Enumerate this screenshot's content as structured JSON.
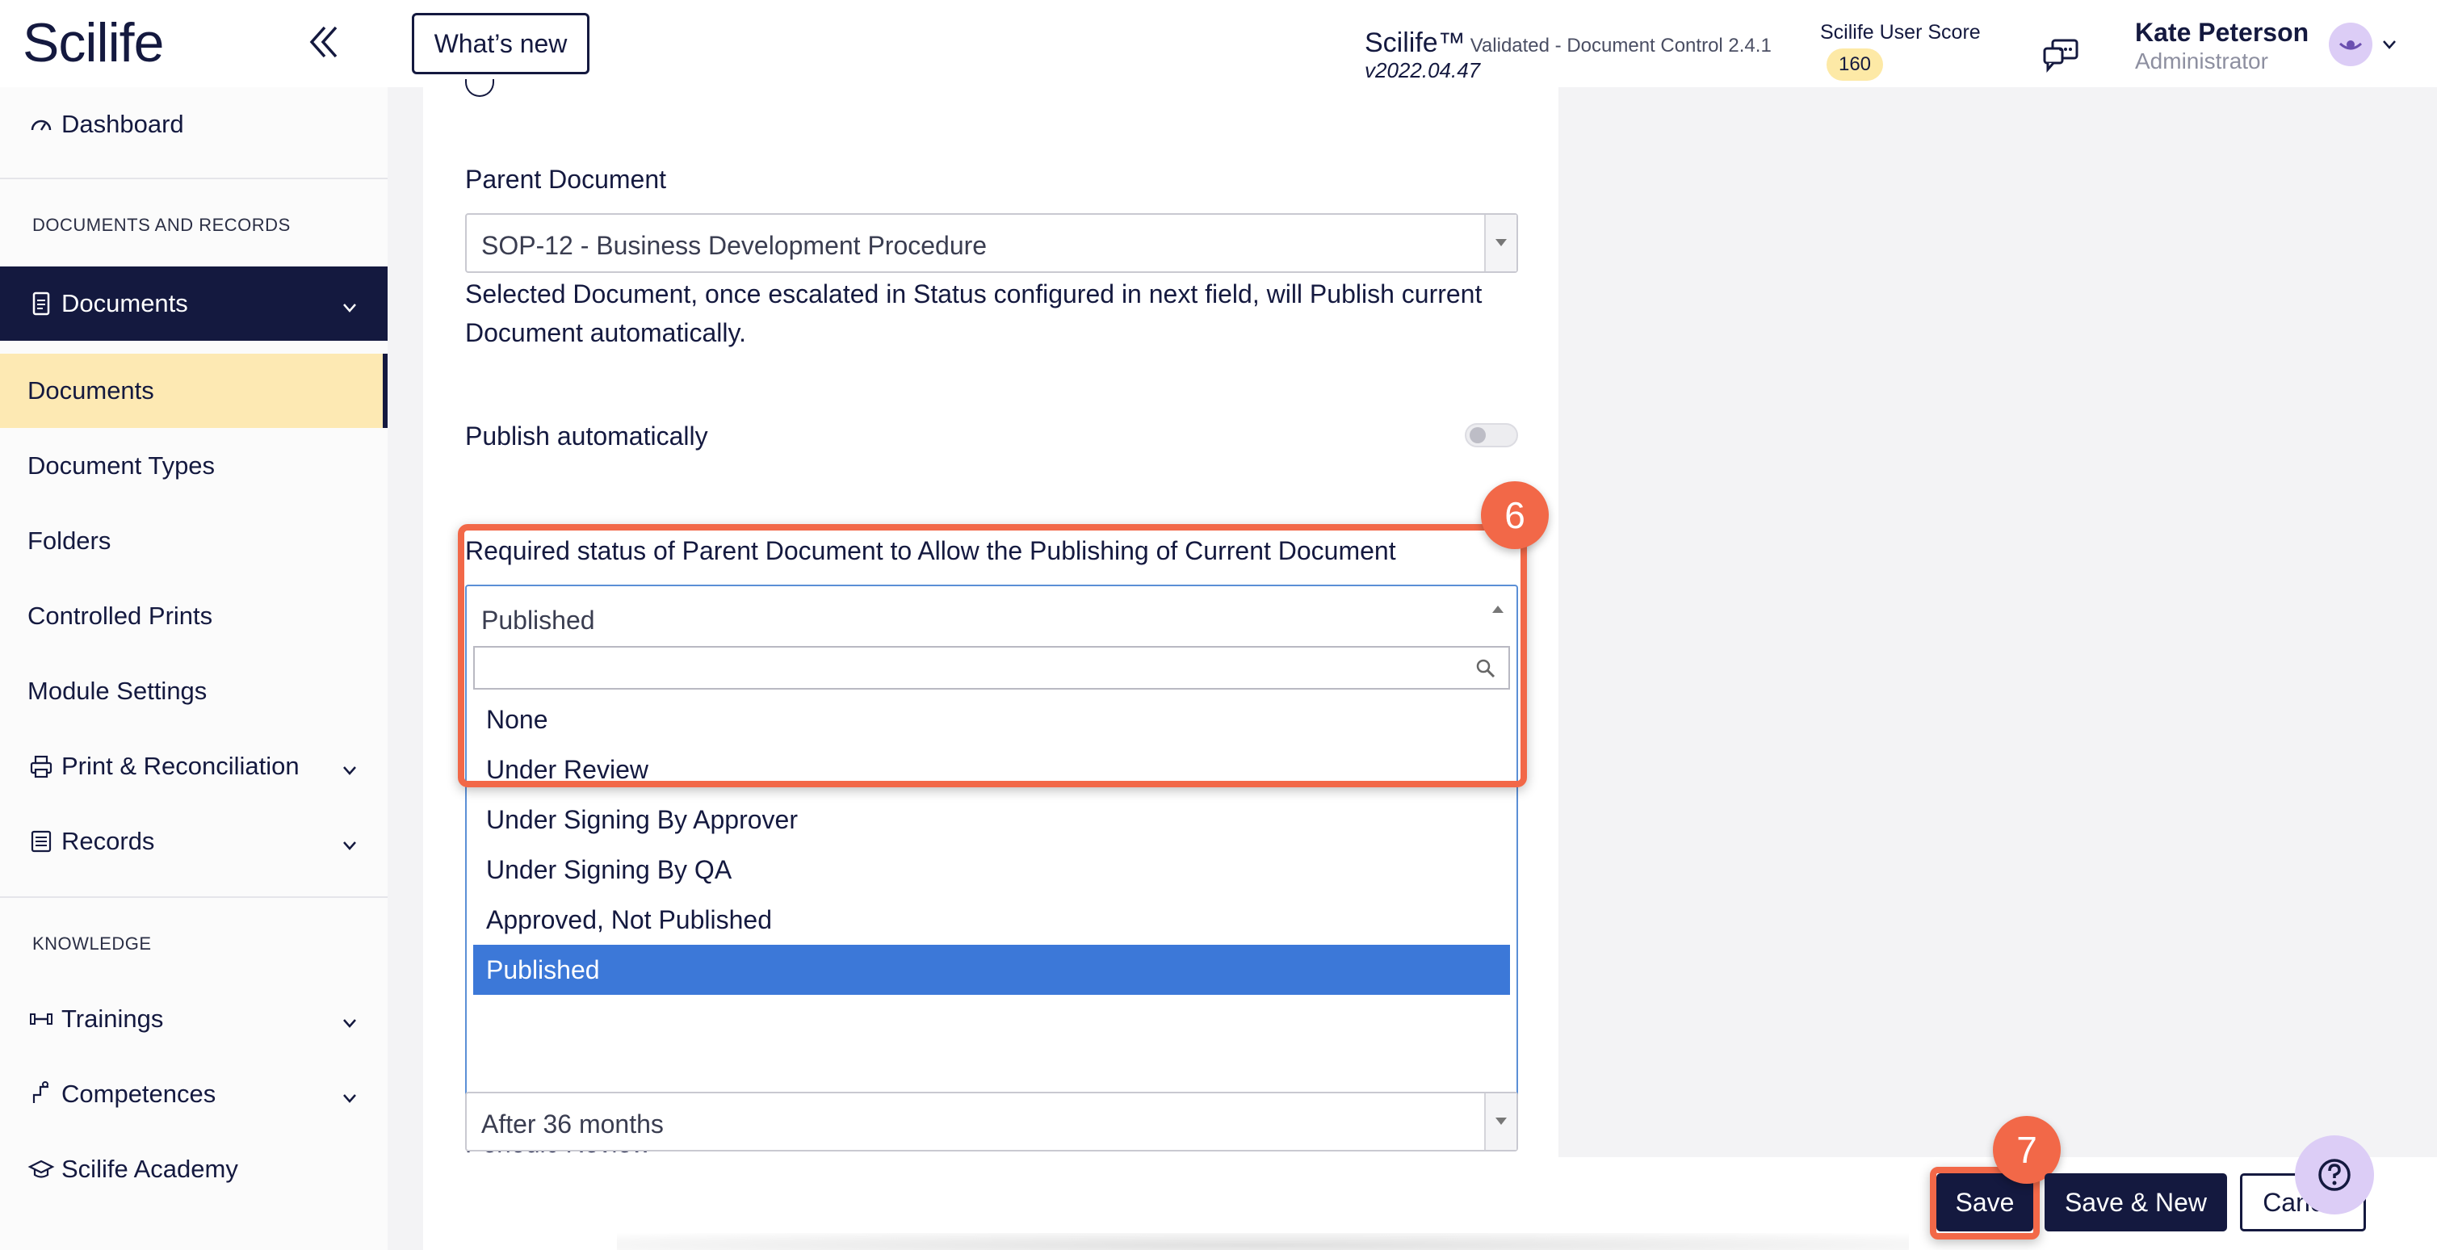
{
  "header": {
    "logo": "Scilife",
    "whats_new": "What’s new",
    "product_name": "Scilife™",
    "product_tag": "Validated - Document Control 2.4.1",
    "product_version": "v2022.04.47",
    "score_label": "Scilife User Score",
    "score_value": "160",
    "user_name": "Kate Peterson",
    "user_role": "Administrator"
  },
  "sidebar": {
    "dashboard": "Dashboard",
    "section_docs": "DOCUMENTS AND RECORDS",
    "documents_parent": "Documents",
    "sub_items": [
      "Documents",
      "Document Types",
      "Folders",
      "Controlled Prints",
      "Module Settings"
    ],
    "print_reconciliation": "Print & Reconciliation",
    "records": "Records",
    "section_knowledge": "KNOWLEDGE",
    "trainings": "Trainings",
    "competences": "Competences",
    "academy": "Scilife Academy"
  },
  "form": {
    "parent_document_label": "Parent Document",
    "parent_document_value": "SOP-12 - Business Development Procedure",
    "parent_document_help": "Selected Document, once escalated in Status configured in next field, will Publish current Document automatically.",
    "publish_automatically_label": "Publish automatically",
    "publish_automatically_on": false,
    "required_status_label": "Required status of Parent Document to Allow the Publishing of Current Document",
    "required_status_value": "Published",
    "required_status_search": "",
    "required_status_options": [
      "None",
      "Under Review",
      "Under Signing By Approver",
      "Under Signing By QA",
      "Approved, Not Published",
      "Published"
    ],
    "required_status_selected_index": 5,
    "periodic_review_label": "Periodic Review",
    "periodic_review_value": "After 36 months"
  },
  "annotations": {
    "step_6": "6",
    "step_7": "7",
    "accent_color": "#f26848"
  },
  "footer": {
    "save": "Save",
    "save_new": "Save & New",
    "cancel": "Cancel"
  },
  "colors": {
    "brand_navy": "#14193f",
    "active_bg": "#fde9b3",
    "option_selected": "#3c78d8",
    "score_badge": "#fde9a6"
  }
}
